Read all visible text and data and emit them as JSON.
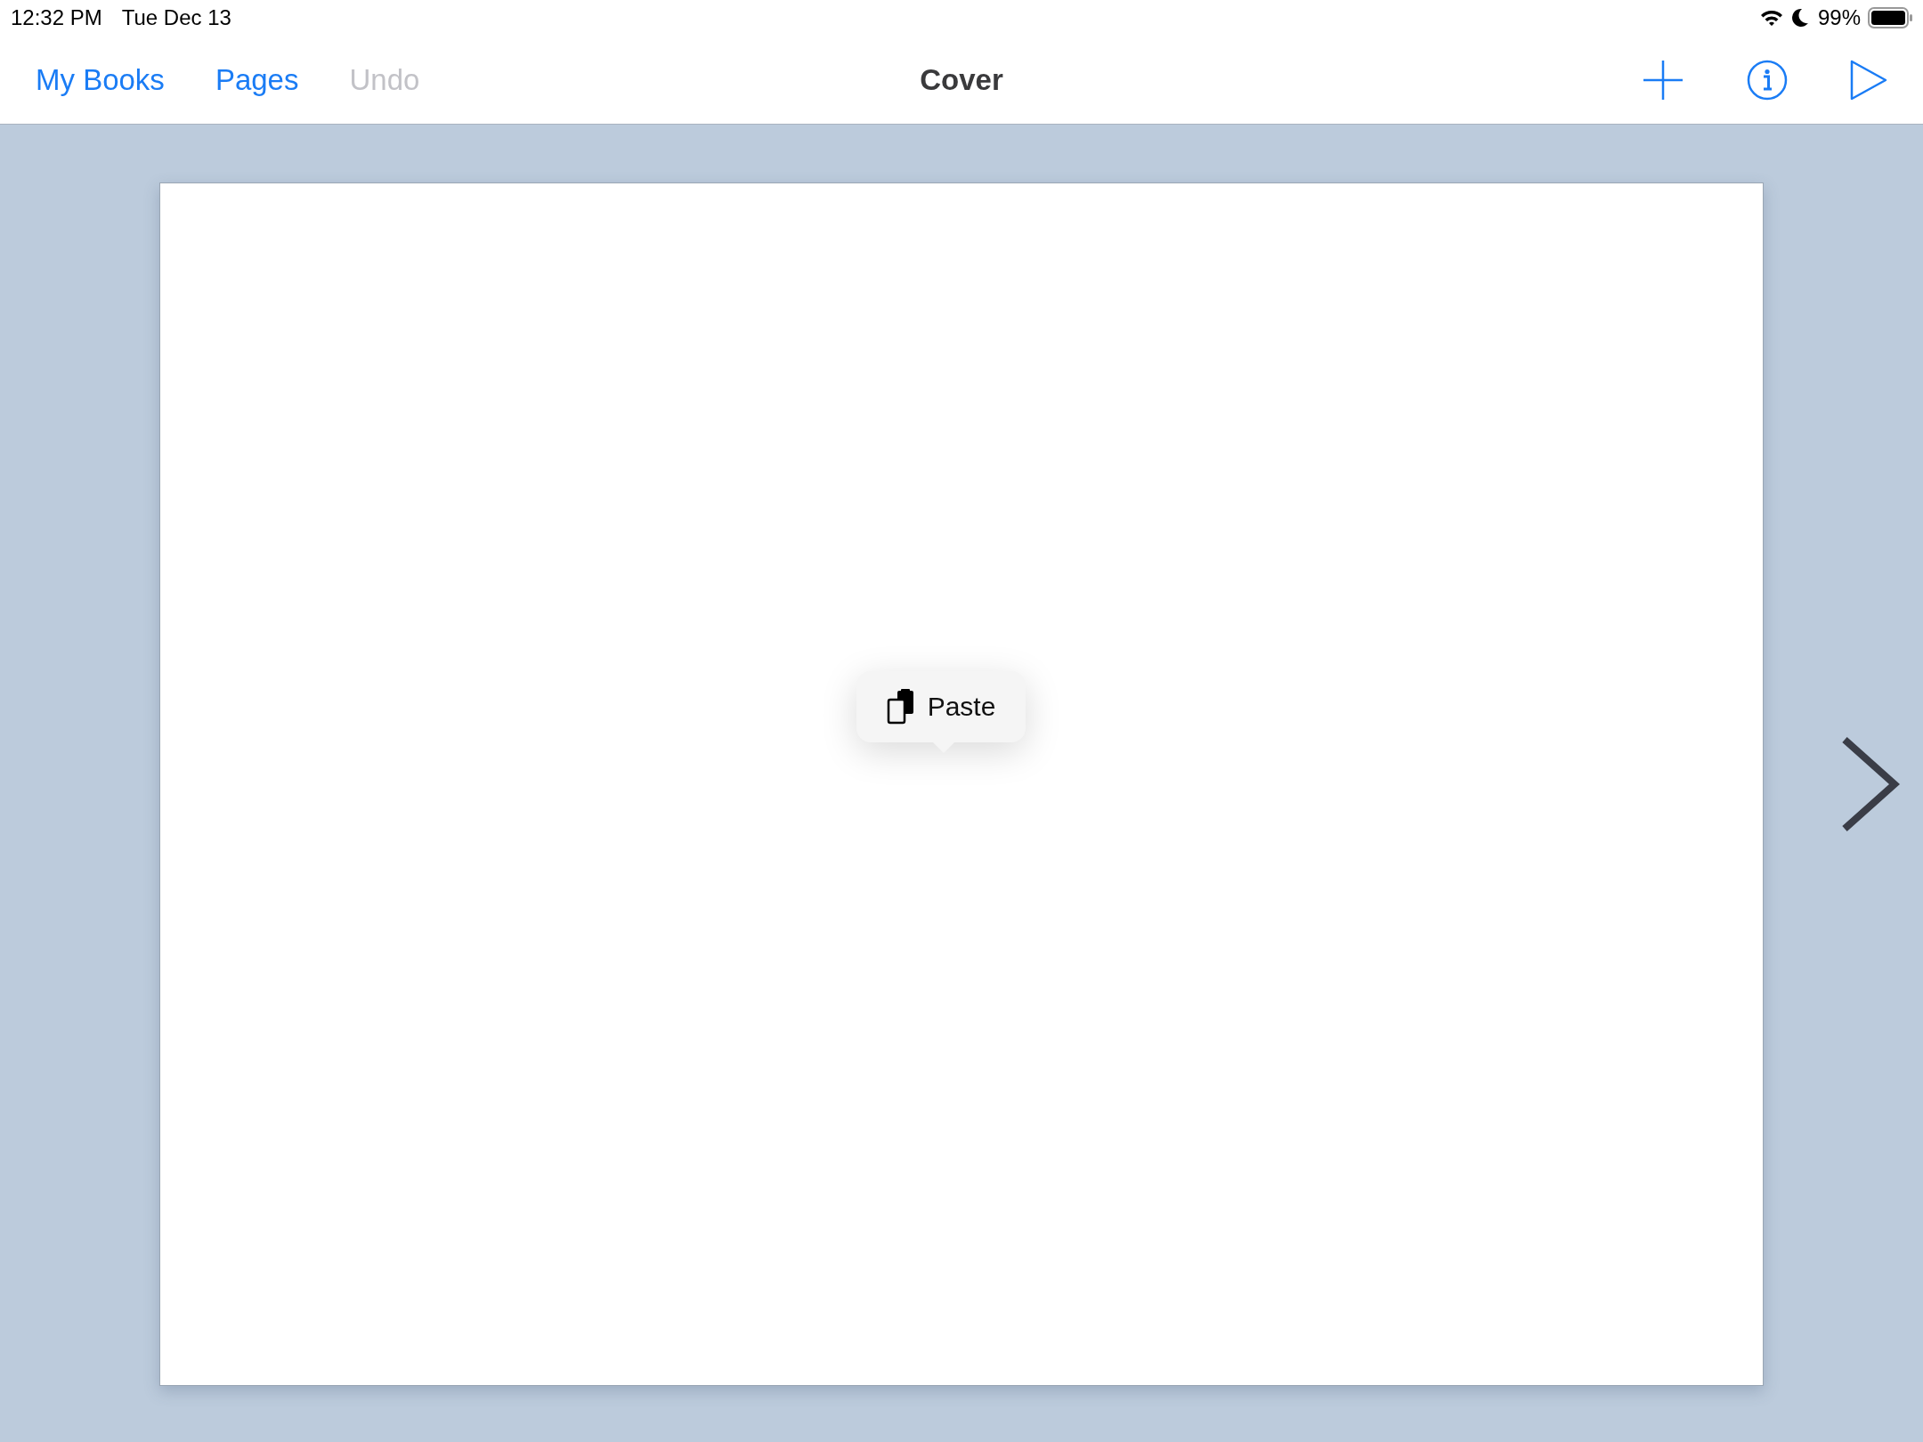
{
  "status_bar": {
    "time": "12:32 PM",
    "date": "Tue Dec 13",
    "battery": "99%"
  },
  "nav": {
    "left": [
      {
        "label": "My Books",
        "disabled": false
      },
      {
        "label": "Pages",
        "disabled": false
      },
      {
        "label": "Undo",
        "disabled": true
      }
    ],
    "title": "Cover"
  },
  "context_menu": {
    "label": "Paste"
  }
}
